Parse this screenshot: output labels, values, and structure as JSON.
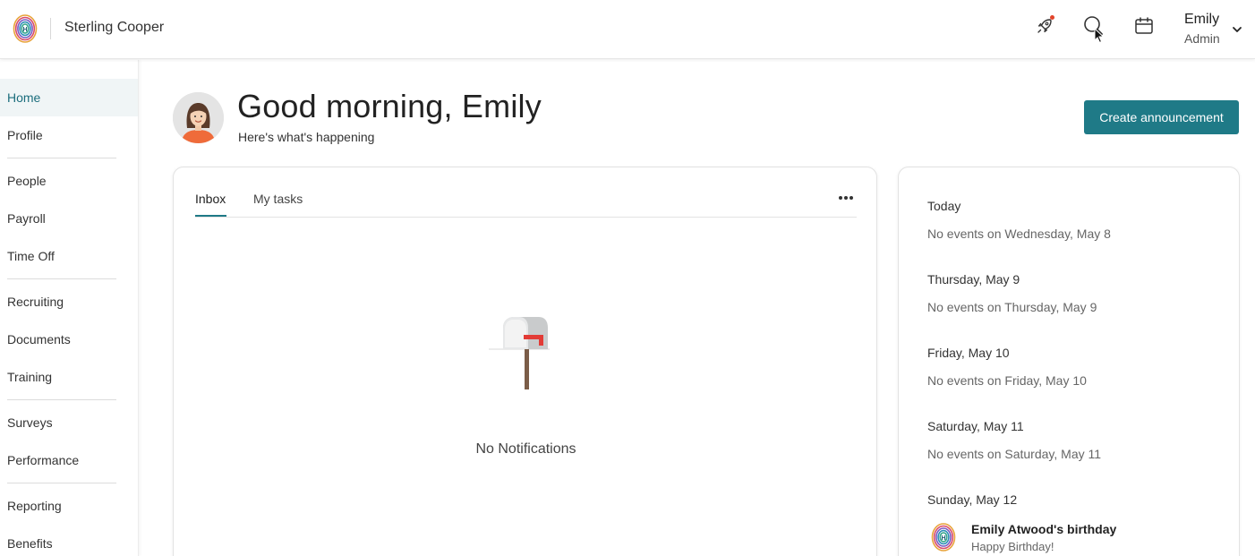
{
  "header": {
    "company": "Sterling Cooper",
    "icons": [
      "rocket-icon",
      "search-icon",
      "calendar-icon"
    ],
    "user": {
      "name": "Emily",
      "role": "Admin"
    }
  },
  "sidebar": {
    "items": [
      {
        "label": "Home",
        "active": true
      },
      {
        "label": "Profile"
      },
      {
        "label": "People"
      },
      {
        "label": "Payroll"
      },
      {
        "label": "Time Off"
      },
      {
        "label": "Recruiting"
      },
      {
        "label": "Documents"
      },
      {
        "label": "Training"
      },
      {
        "label": "Surveys"
      },
      {
        "label": "Performance"
      },
      {
        "label": "Reporting"
      },
      {
        "label": "Benefits"
      }
    ]
  },
  "main": {
    "greeting": "Good morning, Emily",
    "subtitle": "Here's what's happening",
    "create_button": "Create announcement"
  },
  "inbox": {
    "tabs": [
      {
        "label": "Inbox",
        "active": true
      },
      {
        "label": "My tasks"
      }
    ],
    "empty_message": "No Notifications"
  },
  "events": [
    {
      "day": "Today",
      "text": "No events on Wednesday, May 8"
    },
    {
      "day": "Thursday, May 9",
      "text": "No events on Thursday, May 9"
    },
    {
      "day": "Friday, May 10",
      "text": "No events on Friday, May 10"
    },
    {
      "day": "Saturday, May 11",
      "text": "No events on Saturday, May 11"
    },
    {
      "day": "Sunday, May 12",
      "item": {
        "title": "Emily Atwood's birthday",
        "subtitle": "Happy Birthday!"
      }
    }
  ],
  "colors": {
    "accent": "#1f7a87",
    "notification_dot": "#e2432a",
    "active_nav_bg": "#f0f5f6"
  }
}
